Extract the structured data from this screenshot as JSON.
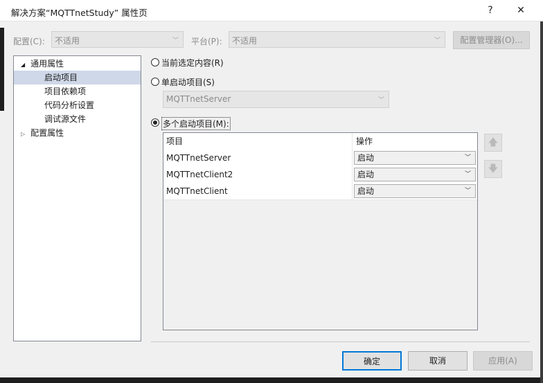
{
  "window": {
    "title": "解决方案“MQTTnetStudy” 属性页",
    "help_label": "?",
    "close_label": "✕"
  },
  "toolbar": {
    "config_label": "配置(C):",
    "config_value": "不适用",
    "platform_label": "平台(P):",
    "platform_value": "不适用",
    "config_manager_label": "配置管理器(O)..."
  },
  "tree": {
    "common_props": "通用属性",
    "startup_project": "启动项目",
    "project_deps": "项目依赖项",
    "code_analysis": "代码分析设置",
    "debug_source": "调试源文件",
    "config_props": "配置属性"
  },
  "options": {
    "current_selection": "当前选定内容(R)",
    "single_startup": "单启动项目(S)",
    "single_startup_value": "MQTTnetServer",
    "multiple_startup": "多个启动项目(M):"
  },
  "grid": {
    "col_project": "项目",
    "col_action": "操作",
    "rows": [
      {
        "project": "MQTTnetServer",
        "action": "启动"
      },
      {
        "project": "MQTTnetClient2",
        "action": "启动"
      },
      {
        "project": "MQTTnetClient",
        "action": "启动"
      }
    ]
  },
  "buttons": {
    "ok": "确定",
    "cancel": "取消",
    "apply": "应用(A)"
  },
  "icons": {
    "up": "arrow-up-icon",
    "down": "arrow-down-icon",
    "dropdown": "chevron-down-icon"
  }
}
